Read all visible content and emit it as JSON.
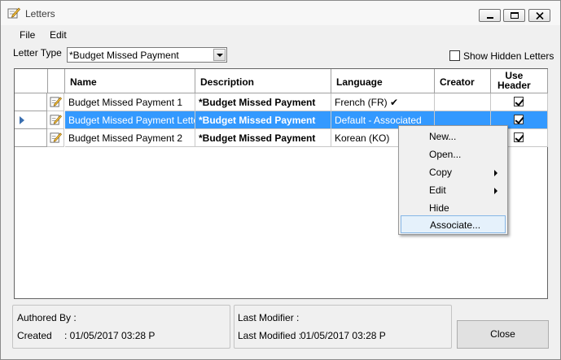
{
  "window": {
    "title": "Letters"
  },
  "menu": {
    "file": "File",
    "edit": "Edit"
  },
  "filter": {
    "letter_type_label": "Letter Type",
    "letter_type_value": "*Budget Missed Payment",
    "show_hidden_label": "Show Hidden Letters"
  },
  "grid": {
    "columns": [
      "Name",
      "Description",
      "Language",
      "Creator",
      "Use\nHeader"
    ],
    "rows": [
      {
        "name": "Budget Missed Payment 1",
        "description": "*Budget Missed Payment",
        "language": "French (FR) ✔",
        "creator": "",
        "use_header": true,
        "selected": false
      },
      {
        "name": "Budget Missed Payment Letter",
        "description": "*Budget Missed Payment",
        "language": "Default - Associated",
        "creator": "",
        "use_header": true,
        "selected": true
      },
      {
        "name": "Budget Missed Payment 2",
        "description": "*Budget Missed Payment",
        "language": "Korean (KO)",
        "creator": "",
        "use_header": true,
        "selected": false
      }
    ]
  },
  "context_menu": {
    "items": [
      {
        "label": "New...",
        "submenu": false
      },
      {
        "label": "Open...",
        "submenu": false
      },
      {
        "label": "Copy",
        "submenu": true
      },
      {
        "label": "Edit",
        "submenu": true
      },
      {
        "label": "Hide",
        "submenu": false
      },
      {
        "label": "Associate...",
        "submenu": false,
        "highlighted": true
      }
    ]
  },
  "info": {
    "authored_by_label": "Authored By :",
    "created_label": "Created",
    "created_value": ":  01/05/2017 03:28 P",
    "last_modifier_label": "Last Modifier  :",
    "last_modified_label": "Last Modified :",
    "last_modified_value": "01/05/2017 03:28 P"
  },
  "buttons": {
    "close": "Close"
  },
  "colors": {
    "selection": "#3399ff",
    "menu_highlight": "#e5f1fb"
  }
}
